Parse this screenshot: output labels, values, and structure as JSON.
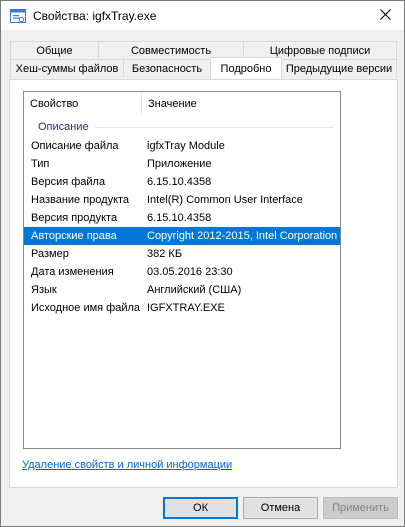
{
  "window": {
    "title": "Свойства: igfxTray.exe"
  },
  "tabs": {
    "row1": [
      {
        "label": "Общие"
      },
      {
        "label": "Совместимость"
      },
      {
        "label": "Цифровые подписи"
      }
    ],
    "row2": [
      {
        "label": "Хеш-суммы файлов"
      },
      {
        "label": "Безопасность"
      },
      {
        "label": "Подробно",
        "active": true
      },
      {
        "label": "Предыдущие версии"
      }
    ]
  },
  "details": {
    "col_property": "Свойство",
    "col_value": "Значение",
    "group": "Описание",
    "rows": [
      {
        "property": "Описание файла",
        "value": "igfxTray Module"
      },
      {
        "property": "Тип",
        "value": "Приложение"
      },
      {
        "property": "Версия файла",
        "value": "6.15.10.4358"
      },
      {
        "property": "Название продукта",
        "value": "Intel(R) Common User Interface"
      },
      {
        "property": "Версия продукта",
        "value": "6.15.10.4358"
      },
      {
        "property": "Авторские права",
        "value": "Copyright 2012-2015, Intel Corporation",
        "selected": true
      },
      {
        "property": "Размер",
        "value": "382 КБ"
      },
      {
        "property": "Дата изменения",
        "value": "03.05.2016 23:30"
      },
      {
        "property": "Язык",
        "value": "Английский (США)"
      },
      {
        "property": "Исходное имя файла",
        "value": "IGFXTRAY.EXE"
      }
    ]
  },
  "remove_link": "Удаление свойств и личной информации",
  "buttons": {
    "ok": "ОК",
    "cancel": "Отмена",
    "apply": "Применить"
  },
  "colors": {
    "selection": "#0078d7",
    "link": "#0066cc",
    "group_label": "#1e3287"
  },
  "icons": {
    "app": "properties-window-icon",
    "close": "close-icon"
  }
}
